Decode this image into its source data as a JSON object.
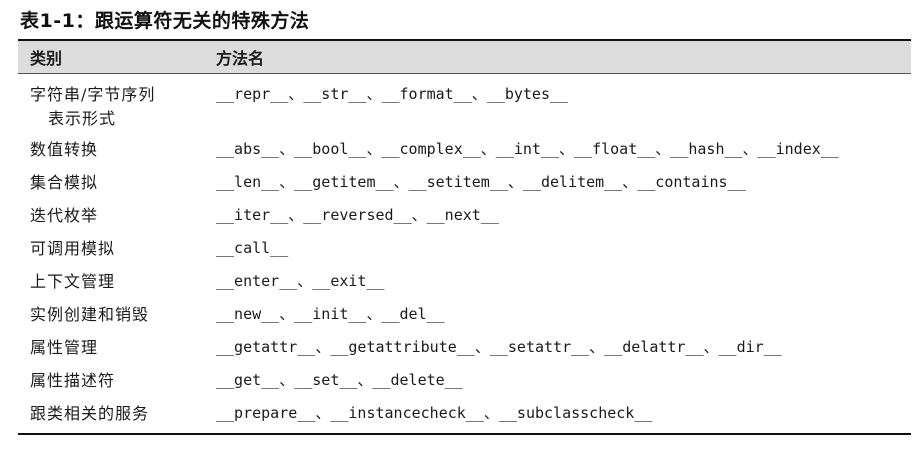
{
  "caption": "表1-1：跟运算符无关的特殊方法",
  "table": {
    "headers": [
      "类别",
      "方法名"
    ],
    "rows": [
      {
        "category": "字符串/字节序列",
        "category_line2": "表示形式",
        "methods": "__repr__、__str__、__format__、__bytes__"
      },
      {
        "category": "数值转换",
        "methods": "__abs__、__bool__、__complex__、__int__、__float__、__hash__、__index__"
      },
      {
        "category": "集合模拟",
        "methods": "__len__、__getitem__、__setitem__、__delitem__、__contains__"
      },
      {
        "category": "迭代枚举",
        "methods": "__iter__、__reversed__、__next__"
      },
      {
        "category": "可调用模拟",
        "methods": "__call__"
      },
      {
        "category": "上下文管理",
        "methods": "__enter__、__exit__"
      },
      {
        "category": "实例创建和销毁",
        "methods": "__new__、__init__、__del__"
      },
      {
        "category": "属性管理",
        "methods": "__getattr__、__getattribute__、__setattr__、__delattr__、__dir__"
      },
      {
        "category": "属性描述符",
        "methods": "__get__、__set__、__delete__"
      },
      {
        "category": "跟类相关的服务",
        "methods": "__prepare__、__instancecheck__、__subclasscheck__"
      }
    ]
  }
}
